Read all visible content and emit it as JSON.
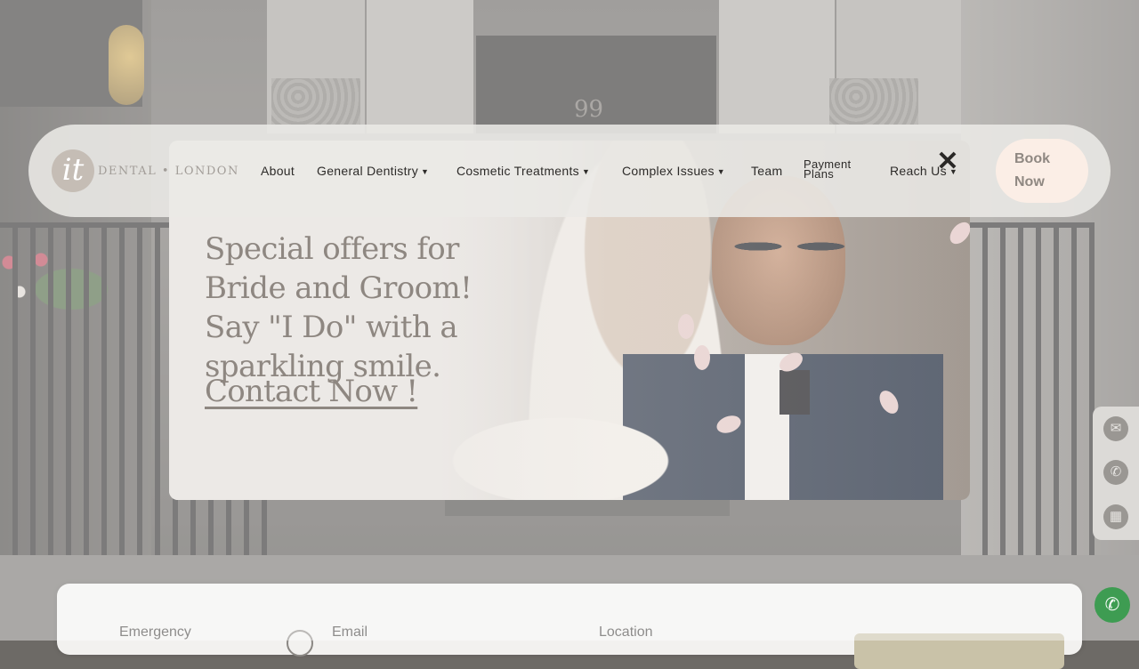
{
  "navbar": {
    "logo_mark": "it",
    "logo_text": "DENTAL • LONDON",
    "items": [
      {
        "label": "About"
      },
      {
        "label": "General Dentistry"
      },
      {
        "label": "Cosmetic Treatments"
      },
      {
        "label": "Complex Issues"
      },
      {
        "label": "Team"
      },
      {
        "label_line1": "Payment",
        "label_line2": "Plans"
      },
      {
        "label": "Reach Us"
      }
    ],
    "book_line1": "Book",
    "book_line2": "Now"
  },
  "hero": {
    "door_number": "99"
  },
  "popup": {
    "headline": "Special offers for Bride and Groom! Say \"I Do\" with a sparkling smile.",
    "cta": "Contact Now !",
    "close_symbol": "✕"
  },
  "info_strip": {
    "emergency_label": "Emergency",
    "email_label": "Email",
    "location_label": "Location"
  },
  "side_rail": {
    "icons": [
      "email-icon",
      "phone-icon",
      "calendar-icon"
    ]
  },
  "whatsapp_symbol": "✆",
  "colors": {
    "book_button_bg": "#fbeee6",
    "popup_text": "#8e8781",
    "whatsapp": "#3e9c52"
  }
}
